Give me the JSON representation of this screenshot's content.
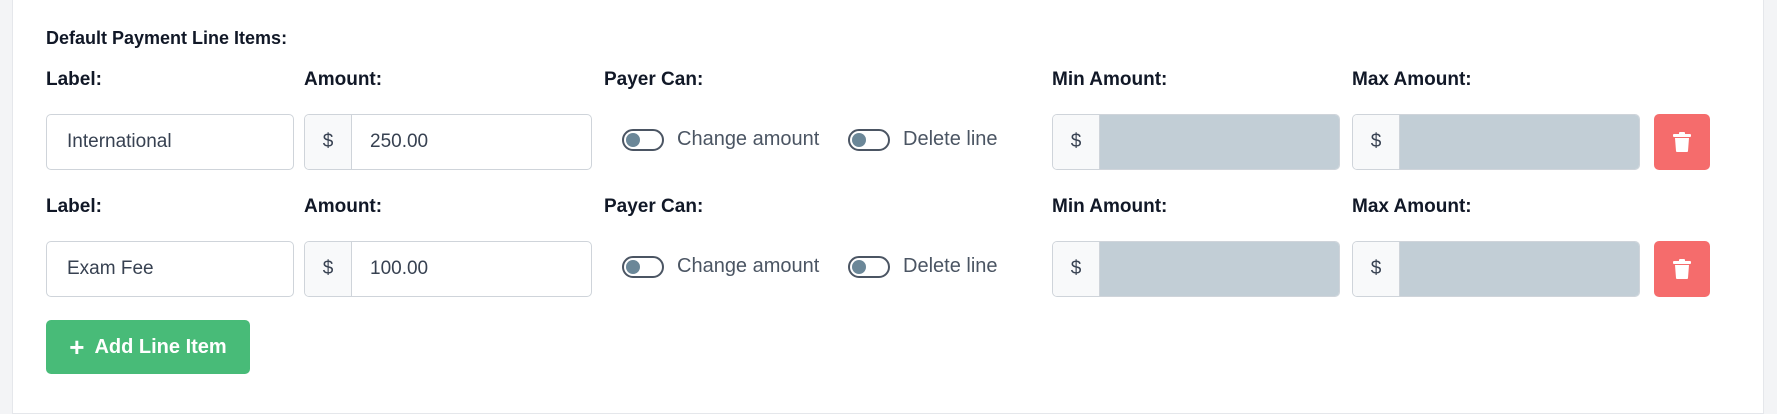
{
  "section": {
    "title": "Default Payment Line Items:"
  },
  "line_items": [
    {
      "label_caption": "Label:",
      "label_value": "International",
      "amount_caption": "Amount:",
      "currency": "$",
      "amount_value": "250.00",
      "payer_can_caption": "Payer Can:",
      "change_amount": {
        "label": "Change amount",
        "enabled": false
      },
      "delete_line": {
        "label": "Delete line",
        "enabled": false
      },
      "min_caption": "Min Amount:",
      "min_value": "",
      "max_caption": "Max Amount:",
      "max_value": ""
    },
    {
      "label_caption": "Label:",
      "label_value": "Exam Fee",
      "amount_caption": "Amount:",
      "currency": "$",
      "amount_value": "100.00",
      "payer_can_caption": "Payer Can:",
      "change_amount": {
        "label": "Change amount",
        "enabled": false
      },
      "delete_line": {
        "label": "Delete line",
        "enabled": false
      },
      "min_caption": "Min Amount:",
      "min_value": "",
      "max_caption": "Max Amount:",
      "max_value": ""
    }
  ],
  "actions": {
    "add_line_item": "Add Line Item"
  },
  "colors": {
    "delete_button": "#f56c6c",
    "add_button": "#48bb78",
    "disabled_field": "#c2ced6"
  },
  "icons": {
    "delete": "trash-icon",
    "add": "plus-icon"
  }
}
